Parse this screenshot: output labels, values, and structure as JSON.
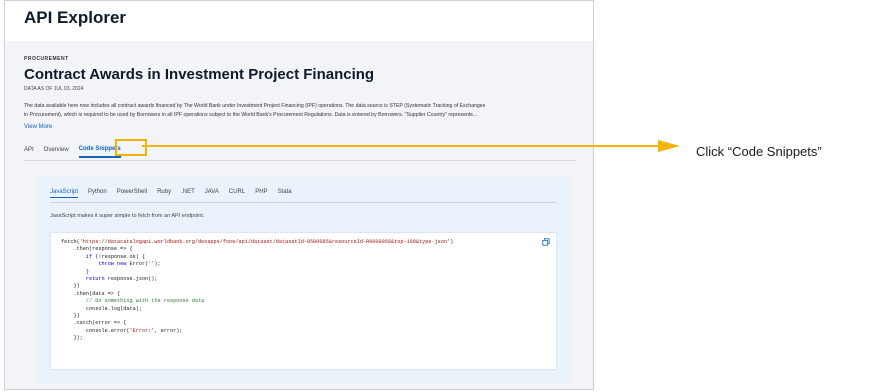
{
  "app": {
    "title": "API Explorer"
  },
  "dataset": {
    "category": "PROCUREMENT",
    "title": "Contract Awards in Investment Project Financing",
    "data_as_of": "DATA AS OF JUL 03, 2024",
    "description_line1": "The data available here now includes all contract awards financed by The World Bank under Investment Project Financing (IPF) operations. The data source is STEP (Systematic Tracking of Exchanges",
    "description_line2": "in Procurement), which is required to be used by Borrowers in all IPF operations subject to the World Bank's Procurement Regulations. Data is entered by Borrowers. \"Supplier Country\" represents...",
    "view_more": "View More"
  },
  "tabs": [
    {
      "label": "API",
      "active": false
    },
    {
      "label": "Overview",
      "active": false
    },
    {
      "label": "Code Snippets",
      "active": true
    }
  ],
  "snippets": {
    "languages": [
      "JavaScript",
      "Python",
      "PowerShell",
      "Ruby",
      ".NET",
      "JAVA",
      "CURL",
      "PHP",
      "Stata"
    ],
    "active_language": "JavaScript",
    "intro": "JavaScript makes it super simple to fetch from an API endpoint.",
    "code": {
      "l1_a": "fetch(",
      "l1_url": "'https://datacatalogapi.worldbank.org/dexapps/fone/api/dataset/datasetId-0500085&resourceId-R0000058&top-100&type-json'",
      "l1_b": ")",
      "l2": "    .then(response => {",
      "l3_a": "        ",
      "l3_kw": "if",
      "l3_b": " (!response.ok) {",
      "l4_a": "            ",
      "l4_kw": "throw new",
      "l4_b": " Error(",
      "l4_str": "''",
      "l4_c": ");",
      "l5": "        }",
      "l6_a": "        ",
      "l6_kw": "return",
      "l6_b": " response.json();",
      "l7": "    })",
      "l8": "    .then(data => {",
      "l9": "        // Do something with the response data",
      "l10": "        console.log(data);",
      "l11": "    })",
      "l12": "    .catch(error => {",
      "l13_a": "        console.error(",
      "l13_str": "'Error:'",
      "l13_b": ", error);",
      "l14": "    });"
    }
  },
  "annotation": {
    "instruction": "Click “Code Snippets”",
    "accent_color": "#f2b400"
  },
  "colors": {
    "link": "#1565c0",
    "panel": "#eaf3fb"
  }
}
